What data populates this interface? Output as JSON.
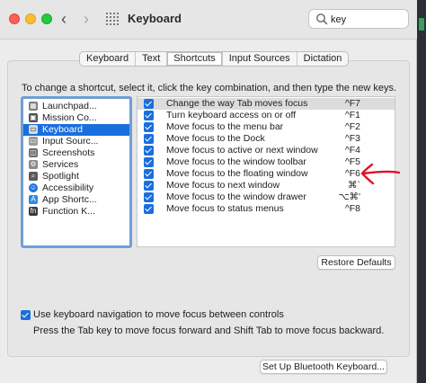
{
  "window": {
    "title": "Keyboard",
    "search": {
      "value": "key",
      "placeholder": "Search"
    }
  },
  "tabs": [
    {
      "label": "Keyboard",
      "selected": false
    },
    {
      "label": "Text",
      "selected": false
    },
    {
      "label": "Shortcuts",
      "selected": true
    },
    {
      "label": "Input Sources",
      "selected": false
    },
    {
      "label": "Dictation",
      "selected": false
    }
  ],
  "instruction": "To change a shortcut, select it, click the key combination, and then type the new keys.",
  "categories": [
    {
      "label": "Launchpad...",
      "icon": "launchpad-icon",
      "selected": false
    },
    {
      "label": "Mission Co...",
      "icon": "mission-control-icon",
      "selected": false
    },
    {
      "label": "Keyboard",
      "icon": "keyboard-icon",
      "selected": true
    },
    {
      "label": "Input Sourc...",
      "icon": "input-sources-icon",
      "selected": false
    },
    {
      "label": "Screenshots",
      "icon": "screenshots-icon",
      "selected": false
    },
    {
      "label": "Services",
      "icon": "services-gear-icon",
      "selected": false
    },
    {
      "label": "Spotlight",
      "icon": "spotlight-icon",
      "selected": false
    },
    {
      "label": "Accessibility",
      "icon": "accessibility-icon",
      "selected": false
    },
    {
      "label": "App Shortc...",
      "icon": "app-shortcuts-icon",
      "selected": false
    },
    {
      "label": "Function K...",
      "icon": "function-keys-icon",
      "selected": false
    }
  ],
  "shortcuts": [
    {
      "label": "Change the way Tab moves focus",
      "key": "^F7",
      "checked": true
    },
    {
      "label": "Turn keyboard access on or off",
      "key": "^F1",
      "checked": true
    },
    {
      "label": "Move focus to the menu bar",
      "key": "^F2",
      "checked": true
    },
    {
      "label": "Move focus to the Dock",
      "key": "^F3",
      "checked": true
    },
    {
      "label": "Move focus to active or next window",
      "key": "^F4",
      "checked": true
    },
    {
      "label": "Move focus to the window toolbar",
      "key": "^F5",
      "checked": true
    },
    {
      "label": "Move focus to the floating window",
      "key": "^F6",
      "checked": true
    },
    {
      "label": "Move focus to next window",
      "key": "⌘`",
      "checked": true
    },
    {
      "label": "Move focus to the window drawer",
      "key": "⌥⌘'",
      "checked": true
    },
    {
      "label": "Move focus to status menus",
      "key": "^F8",
      "checked": true
    }
  ],
  "buttons": {
    "restore_defaults": "Restore Defaults",
    "bluetooth_keyboard": "Set Up Bluetooth Keyboard..."
  },
  "keyboard_navigation": {
    "checked": true,
    "label": "Use keyboard navigation to move focus between controls",
    "hint": "Press the Tab key to move focus forward and Shift Tab to move focus backward."
  },
  "colors": {
    "accent": "#1a6fde",
    "annotation_arrow": "#e0102a"
  }
}
